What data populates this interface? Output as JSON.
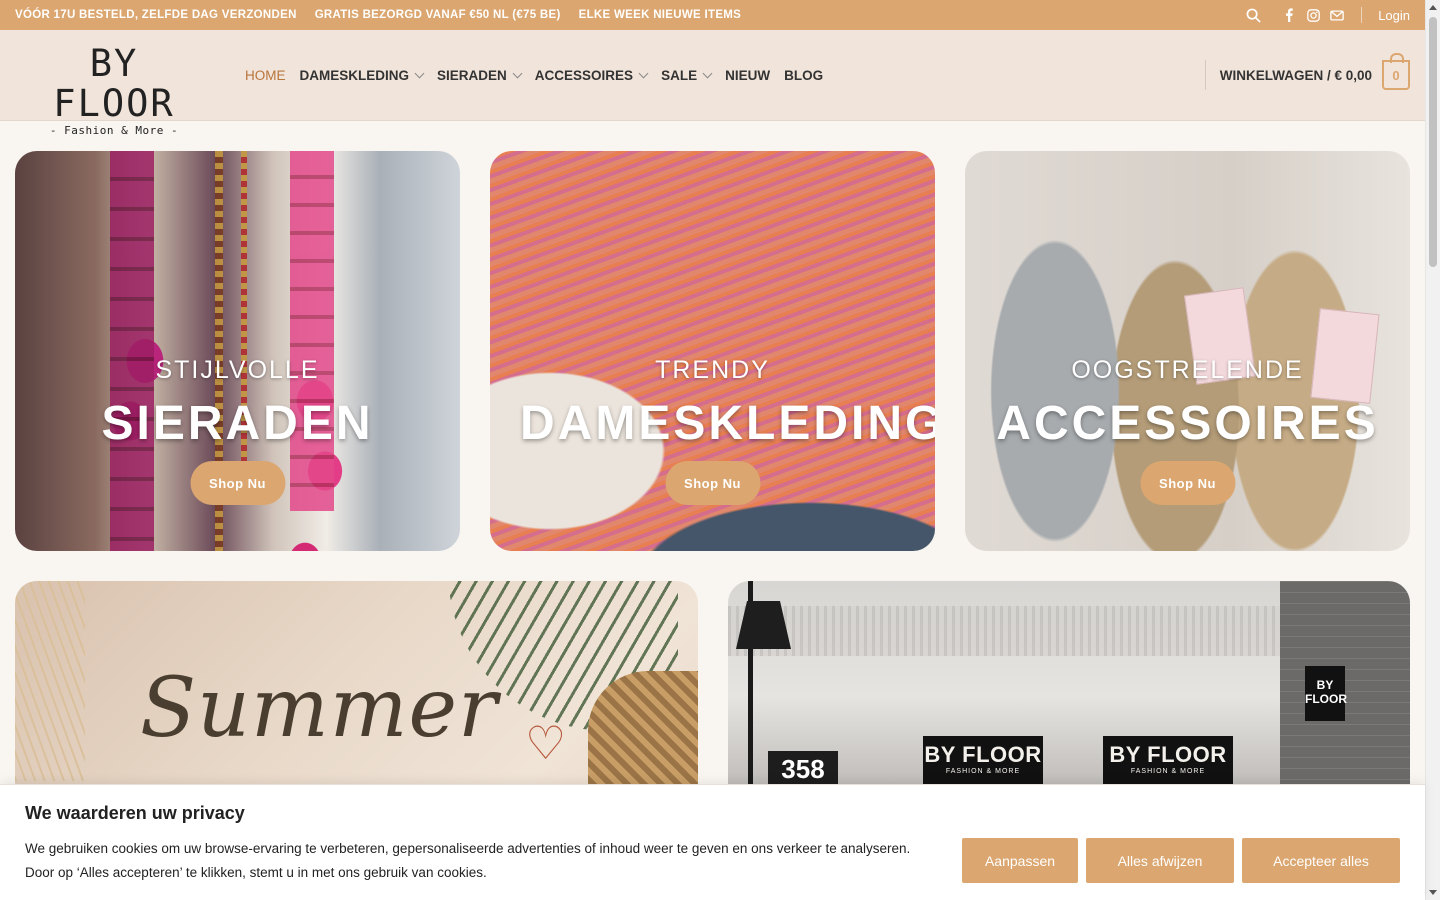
{
  "topbar": {
    "messages": [
      "VÓÓR 17U BESTELD, ZELFDE DAG VERZONDEN",
      "GRATIS BEZORGD VANAF €50 NL (€75 BE)",
      "ELKE WEEK NIEUWE ITEMS"
    ],
    "login": "Login",
    "icons": [
      "search-icon",
      "facebook-icon",
      "instagram-icon",
      "email-icon"
    ]
  },
  "header": {
    "logo_main": "BY FLOOR",
    "logo_sub": "- Fashion & More -",
    "nav": [
      {
        "label": "HOME",
        "active": true,
        "dropdown": false
      },
      {
        "label": "DAMESKLEDING",
        "active": false,
        "dropdown": true
      },
      {
        "label": "SIERADEN",
        "active": false,
        "dropdown": true
      },
      {
        "label": "ACCESSOIRES",
        "active": false,
        "dropdown": true
      },
      {
        "label": "SALE",
        "active": false,
        "dropdown": true
      },
      {
        "label": "NIEUW",
        "active": false,
        "dropdown": false
      },
      {
        "label": "BLOG",
        "active": false,
        "dropdown": false
      }
    ],
    "cart_label": "WINKELWAGEN / € 0,00",
    "cart_count": "0"
  },
  "cards": [
    {
      "eyebrow": "STIJLVOLLE",
      "title": "SIERADEN",
      "button": "Shop Nu"
    },
    {
      "eyebrow": "TRENDY",
      "title": "DAMESKLEDING",
      "button": "Shop Nu"
    },
    {
      "eyebrow": "OOGSTRELENDE",
      "title": "ACCESSOIRES",
      "button": "Shop Nu"
    }
  ],
  "banners": {
    "summer_text": "Summer",
    "store_sign": "BY FLOOR",
    "store_sign_sub": "FASHION & MORE",
    "house_number": "358",
    "side_sign": "BY FLOOR"
  },
  "cookie": {
    "heading": "We waarderen uw privacy",
    "text": "We gebruiken cookies om uw browse-ervaring te verbeteren, gepersonaliseerde advertenties of inhoud weer te geven en ons verkeer te analyseren. Door op ‘Alles accepteren’ te klikken, stemt u in met ons gebruik van cookies.",
    "buttons": [
      "Aanpassen",
      "Alles afwijzen",
      "Accepteer alles"
    ]
  },
  "colors": {
    "accent": "#dba66f",
    "header_bg": "#f1e4da",
    "active_nav": "#b8753c"
  }
}
